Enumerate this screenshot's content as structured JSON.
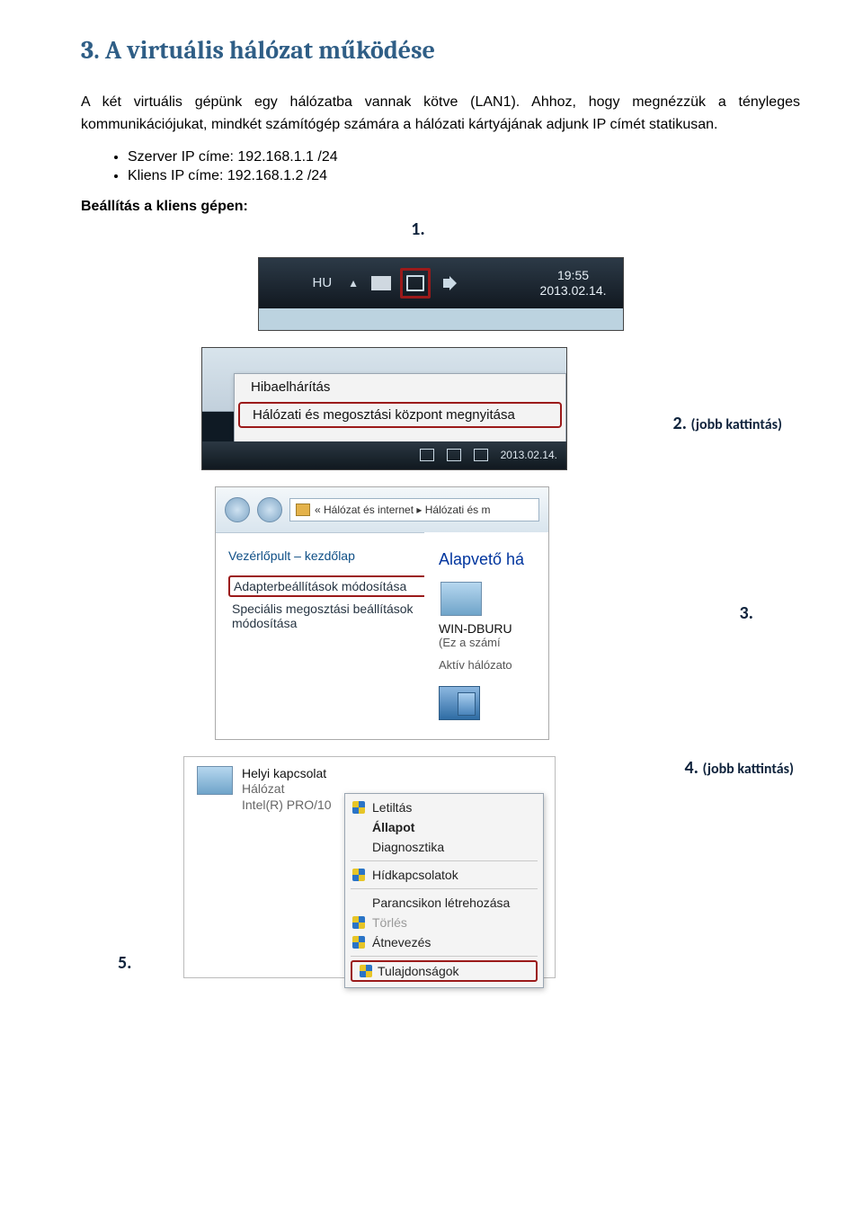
{
  "heading": "3. A virtuális hálózat működése",
  "para": "A két virtuális gépünk egy hálózatba vannak kötve (LAN1). Ahhoz, hogy megnézzük a tényleges kommunikációjukat, mindkét számítógép számára a hálózati kártyájának adjunk IP címét statikusan.",
  "bullets": {
    "server": "Szerver IP címe: 192.168.1.1 /24",
    "client": "Kliens IP címe: 192.168.1.2 /24"
  },
  "subhead": "Beállítás a kliens gépen:",
  "callouts": {
    "c1": "1.",
    "c2": {
      "num": "2.",
      "note": "(jobb kattintás)"
    },
    "c3": "3.",
    "c4": {
      "num": "4.",
      "note": "(jobb kattintás)"
    },
    "c5": "5."
  },
  "fig1": {
    "lang": "HU",
    "time": "19:55",
    "date": "2013.02.14."
  },
  "fig2": {
    "item1": "Hibaelhárítás",
    "item2": "Hálózati és megosztási központ megnyitása",
    "mini_date": "2013.02.14."
  },
  "fig3": {
    "breadcrumb": "« Hálózat és internet ▸ Hálózati és m",
    "side_title": "Vezérlőpult – kezdőlap",
    "side_link1": "Adapterbeállítások módosítása",
    "side_link2": "Speciális megosztási beállítások módosítása",
    "main_head": "Alapvető há",
    "comp_name": "WIN-DBURU",
    "comp_sub": "(Ez a számí",
    "active": "Aktív hálózato"
  },
  "fig4": {
    "adapter_name": "Helyi kapcsolat",
    "adapter_net": "Hálózat",
    "adapter_driver": "Intel(R) PRO/10",
    "menu": {
      "disable": "Letiltás",
      "status": "Állapot",
      "diag": "Diagnosztika",
      "bridge": "Hídkapcsolatok",
      "shortcut": "Parancsikon létrehozása",
      "delete": "Törlés",
      "rename": "Átnevezés",
      "props": "Tulajdonságok"
    }
  }
}
